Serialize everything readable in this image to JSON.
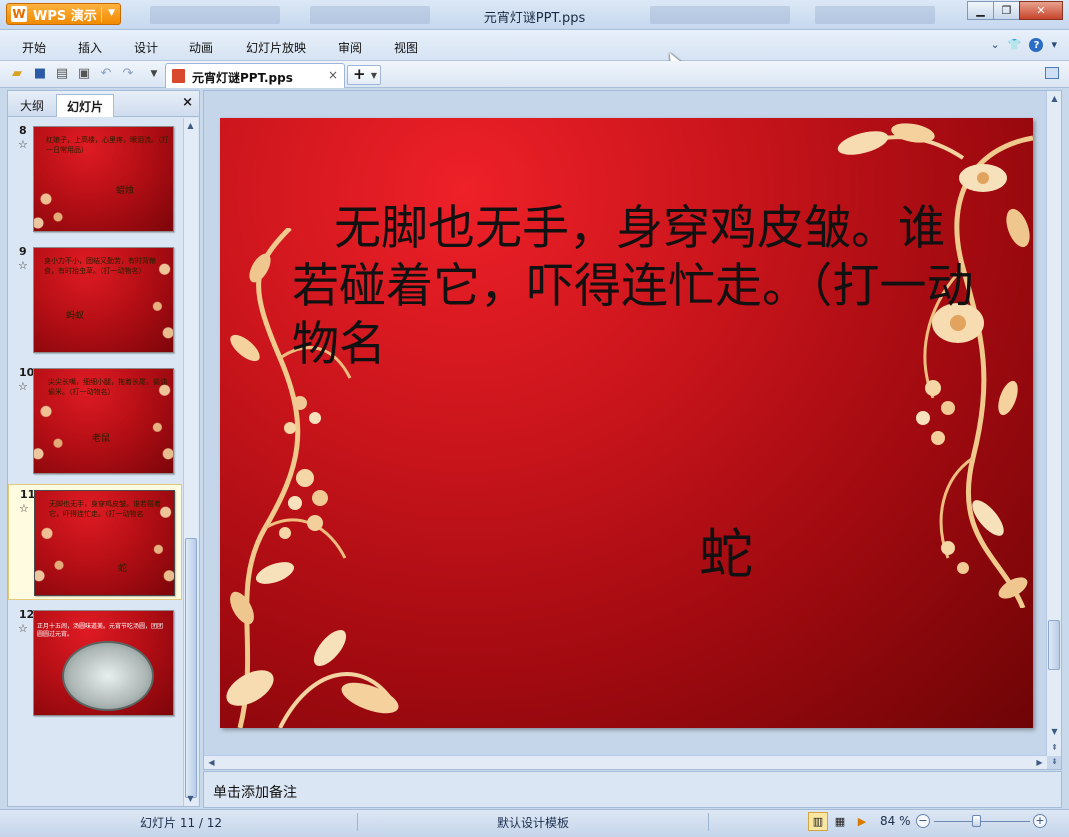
{
  "app": {
    "brand_button": "WPS 演示",
    "window_title": "元宵灯谜PPT.pps"
  },
  "menu": {
    "items": [
      "开始",
      "插入",
      "设计",
      "动画",
      "幻灯片放映",
      "审阅",
      "视图"
    ]
  },
  "document_tab": {
    "label": "元宵灯谜PPT.pps",
    "close": "×",
    "new_tab": "+"
  },
  "left_panel": {
    "tabs": [
      "大纲",
      "幻灯片"
    ],
    "active_tab": "幻灯片",
    "close": "×",
    "slides": [
      {
        "number": "8",
        "text": "红娘子，上高楼，心里疼，眼泪流。（打一日常用品）",
        "answer": "蜡烛"
      },
      {
        "number": "9",
        "text": "身小力不小，团结又勤劳，有时背粮食，有时抬虫草。（打一动物名）",
        "answer": "蚂蚁"
      },
      {
        "number": "10",
        "text": "尖尖长嘴，细细小腿，拖着长尾，偷油偷米。（打一动物名）",
        "answer": "老鼠"
      },
      {
        "number": "11",
        "text": "无脚也无手，身穿鸡皮皱。谁若碰着它，吓得连忙走。（打一动物名",
        "answer": "蛇"
      },
      {
        "number": "12",
        "text": "正月十五闹，汤圆味道美。元宵节吃汤圆，团团圆圆过元宵。",
        "answer": ""
      }
    ],
    "selected_index": 3
  },
  "slide": {
    "riddle": "无脚也无手，身穿鸡皮皱。谁若碰着它，吓得连忙走。（打一动物名",
    "answer": "蛇"
  },
  "notes": {
    "placeholder": "单击添加备注"
  },
  "statusbar": {
    "slide_indicator": "幻灯片 11 / 12",
    "template": "默认设计模板",
    "zoom": "84 %",
    "zoom_level": 0.44
  },
  "colors": {
    "slide_red": "#c8141b",
    "wps_orange": "#f08a00",
    "selection_yellow": "#fffbe0"
  }
}
